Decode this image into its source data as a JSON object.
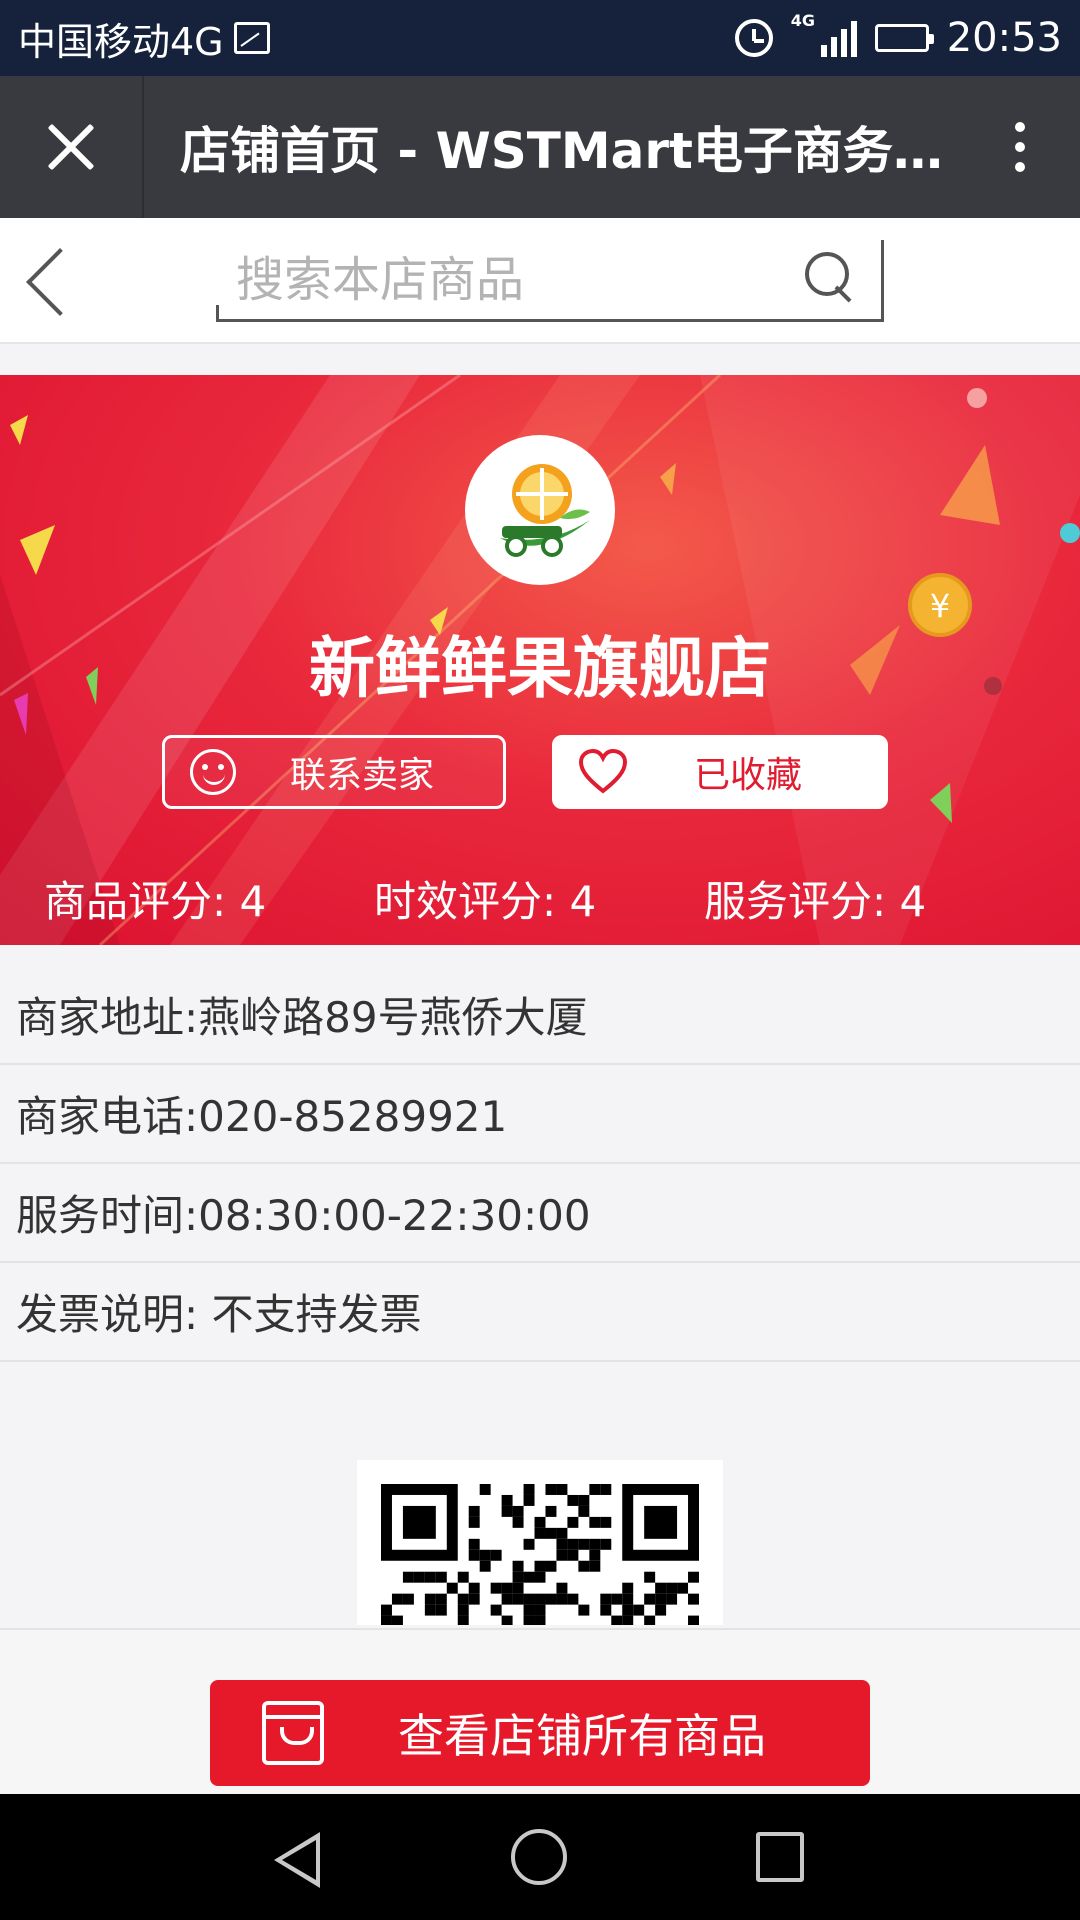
{
  "status_bar": {
    "carrier": "中国移动4G",
    "network_badge": "4G",
    "time": "20:53",
    "icons": [
      "image-icon",
      "alarm-icon",
      "signal-icon",
      "battery-icon"
    ]
  },
  "title_bar": {
    "title": "店铺首页 - WSTMart电子商务…",
    "icons": [
      "close-icon",
      "more-icon"
    ]
  },
  "search": {
    "placeholder": "搜索本店商品",
    "value": ""
  },
  "shop": {
    "name": "新鲜鲜果旗舰店",
    "contact_label": "联系卖家",
    "favorite_label": "已收藏",
    "ratings": [
      {
        "label": "商品评分",
        "sep": ":",
        "value": "4"
      },
      {
        "label": "时效评分",
        "sep": ":",
        "value": "4"
      },
      {
        "label": "服务评分",
        "sep": ":",
        "value": "4"
      }
    ]
  },
  "info": {
    "address": "商家地址:燕岭路89号燕侨大厦",
    "phone": "商家电话:020-85289921",
    "hours": "服务时间:08:30:00-22:30:00",
    "invoice": "发票说明: 不支持发票"
  },
  "bottom": {
    "view_all_label": "查看店铺所有商品"
  },
  "colors": {
    "accent_red": "#e6192b",
    "status_bar": "#16223b",
    "title_bar": "#393a3f"
  }
}
